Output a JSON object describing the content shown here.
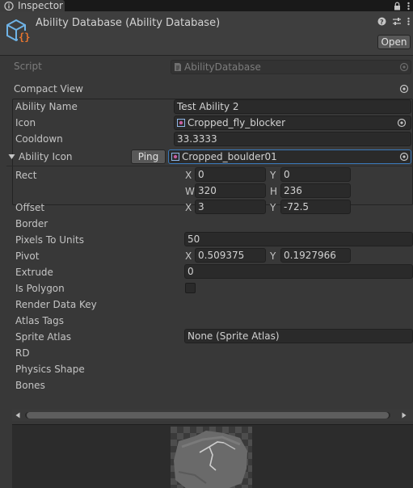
{
  "tab": {
    "label": "Inspector"
  },
  "header": {
    "title": "Ability Database (Ability Database)",
    "open_label": "Open"
  },
  "script": {
    "label": "Script",
    "value": "AbilityDatabase"
  },
  "compact_view": {
    "label": "Compact View"
  },
  "fields": {
    "ability_name": {
      "label": "Ability Name",
      "value": "Test Ability 2"
    },
    "icon": {
      "label": "Icon",
      "value": "Cropped_fly_blocker"
    },
    "cooldown": {
      "label": "Cooldown",
      "value": "33.3333"
    }
  },
  "ability_icon": {
    "label": "Ability Icon",
    "ping_label": "Ping",
    "value": "Cropped_boulder01"
  },
  "sprite": {
    "rect": {
      "label": "Rect",
      "x": "0",
      "y": "0",
      "w": "320",
      "h": "236"
    },
    "offset": {
      "label": "Offset",
      "x": "3",
      "y": "-72.5"
    },
    "border": {
      "label": "Border"
    },
    "pixels_to_units": {
      "label": "Pixels To Units",
      "value": "50"
    },
    "pivot": {
      "label": "Pivot",
      "x": "0.509375",
      "y": "0.1927966"
    },
    "extrude": {
      "label": "Extrude",
      "value": "0"
    },
    "is_polygon": {
      "label": "Is Polygon",
      "checked": false
    },
    "render_data_key": {
      "label": "Render Data Key"
    },
    "atlas_tags": {
      "label": "Atlas Tags"
    },
    "sprite_atlas": {
      "label": "Sprite Atlas",
      "value": "None (Sprite Atlas)"
    },
    "rd": {
      "label": "RD"
    },
    "physics_shape": {
      "label": "Physics Shape"
    },
    "bones": {
      "label": "Bones"
    }
  },
  "axis_letters": {
    "x": "X",
    "y": "Y",
    "w": "W",
    "h": "H"
  },
  "colors": {
    "background": "#383838",
    "field": "#2a2a2a",
    "focus_border": "#3a79bb",
    "text": "#c4c4c4"
  }
}
